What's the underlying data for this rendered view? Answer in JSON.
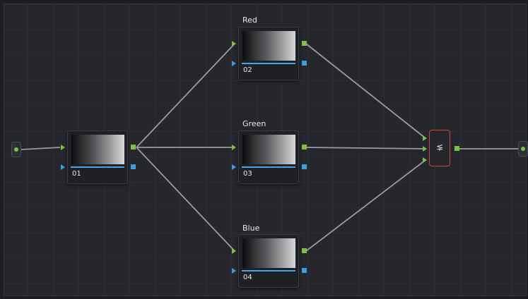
{
  "nodes": [
    {
      "id": "01",
      "title": ""
    },
    {
      "id": "02",
      "title": "Red"
    },
    {
      "id": "03",
      "title": "Green"
    },
    {
      "id": "04",
      "title": "Blue"
    }
  ],
  "combiner": {
    "icon": "layer-mixer-icon",
    "glyph": "⋦"
  },
  "colors": {
    "rgb_port": "#7cc242",
    "key_port": "#3a9fe0",
    "combiner_border": "#c8453d",
    "link": "#9a9ca2"
  }
}
